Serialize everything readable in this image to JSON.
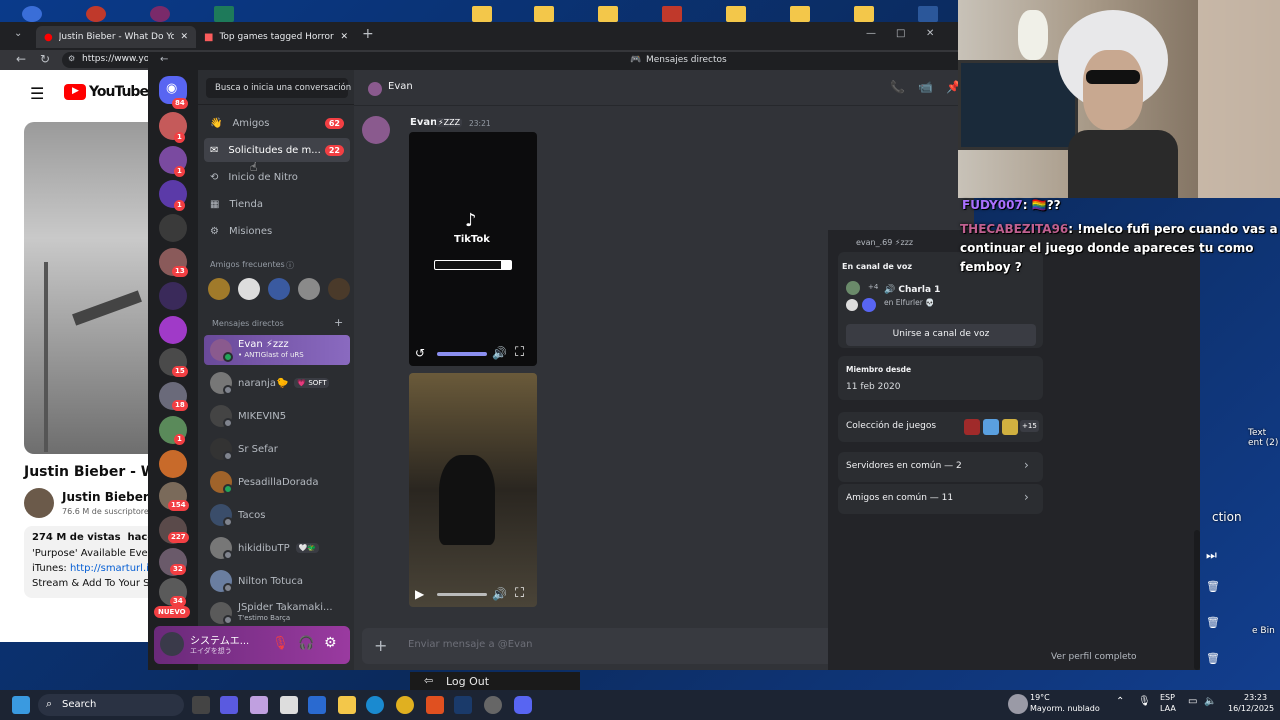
{
  "chrome": {
    "tabs": [
      {
        "title": "Justin Bieber - What Do You Mean",
        "close": "✕"
      },
      {
        "title": "Top games tagged Horror - itch.io",
        "close": "✕"
      }
    ],
    "new_tab": "+",
    "url": "https://www.you",
    "window_controls": [
      "—",
      "□",
      "✕"
    ]
  },
  "youtube": {
    "logo": "YouTube",
    "video_title": "Justin Bieber - Wh",
    "channel": "Justin Bieber",
    "subscribers": "76.6 M de suscriptore",
    "views": "274 M de vistas  hace 10",
    "desc_line1": "'Purpose' Available Every",
    "desc_line2_prefix": "iTunes: ",
    "desc_link": "http://smarturl.it/",
    "desc_line3": "Stream & Add To Your Sp"
  },
  "discord": {
    "title_bar": "Mensajes directos",
    "home_badge": "84",
    "search_placeholder": "Busca o inicia una conversación",
    "nav": [
      {
        "label": "Amigos",
        "count": "62",
        "icon": "friends-icon"
      },
      {
        "label": "Solicitudes de m...",
        "count": "22",
        "icon": "mail-icon"
      },
      {
        "label": "Inicio de Nitro",
        "count": "",
        "icon": "nitro-icon"
      },
      {
        "label": "Tienda",
        "count": "",
        "icon": "shop-icon"
      },
      {
        "label": "Misiones",
        "count": "",
        "icon": "quest-icon"
      }
    ],
    "frequent_title": "Amigos frecuentes",
    "dm_title": "Mensajes directos",
    "dm_add": "+",
    "dms": [
      {
        "name": "Evan ⚡zzz",
        "sub": "• ANTIGlast of uRS",
        "color": "#8a5a8e",
        "online": true
      },
      {
        "name": "naranja🐤",
        "tag": "💗 SOFT",
        "color": "#777",
        "online": false
      },
      {
        "name": "MIKEVIN5",
        "color": "#444",
        "online": false
      },
      {
        "name": "Sr Sefar",
        "color": "#333",
        "online": false
      },
      {
        "name": "PesadillaDorada",
        "color": "#a0632a",
        "online": true
      },
      {
        "name": "Tacos",
        "color": "#3a4d6a",
        "online": false
      },
      {
        "name": "hikidibuTP",
        "tag": "🤍🐲",
        "color": "#777",
        "online": false
      },
      {
        "name": "Nilton Totuca",
        "color": "#6a7ea0",
        "online": false
      },
      {
        "name": "JSpider Takamaki...",
        "sub": "T'estimo Barça",
        "color": "#5a5a5a",
        "online": false
      }
    ],
    "server_badges": [
      "1",
      "1",
      "1",
      "",
      "13",
      "",
      "",
      "15",
      "18",
      "1",
      "",
      "154",
      "227",
      "32",
      "34"
    ],
    "nuevo": "NUEVO",
    "user_panel": {
      "name": "システムエ...",
      "status": "エイダを想う"
    },
    "chat": {
      "recipient": "Evan",
      "author": "Evan",
      "author_tag": "⚡ZZZ",
      "time": "23:21",
      "tiktok_label": "TikTok",
      "input_placeholder": "Enviar mensaje a @Evan"
    },
    "profile": {
      "voice_title": "En canal de voz",
      "voice_extra": "+4",
      "voice_channel": "🔊 Charla 1",
      "voice_server": "en Elfurler 💀",
      "join_voice": "Unirse a canal de voz",
      "member_since_title": "Miembro desde",
      "member_since": "11 feb 2020",
      "games_title": "Colección de juegos",
      "games_extra": "+15",
      "servers_common": "Servidores en común — 2",
      "friends_common": "Amigos en común — 11",
      "full_profile": "Ver perfil completo",
      "handle": "evan_.69 ⚡zzz"
    }
  },
  "overlay": {
    "chat1_user": "FUDY007",
    "chat1_msg": ": 🏳️‍🌈??",
    "chat2_user": "THECABEZITA96",
    "chat2_msg": ": !melco fufi pero cuando vas a continuar el juego donde apareces tu como femboy ?",
    "log_out": "Log Out",
    "right_fragment_action": "ction",
    "right_fragment_text": "Text\nent (2)",
    "right_fragment_bin": "e Bin"
  },
  "taskbar": {
    "search": "Search",
    "weather_temp": "19°C",
    "weather_desc": "Mayorm. nublado",
    "lang1": "ESP",
    "lang2": "LAA",
    "time": "23:23",
    "date": "16/12/2025"
  }
}
